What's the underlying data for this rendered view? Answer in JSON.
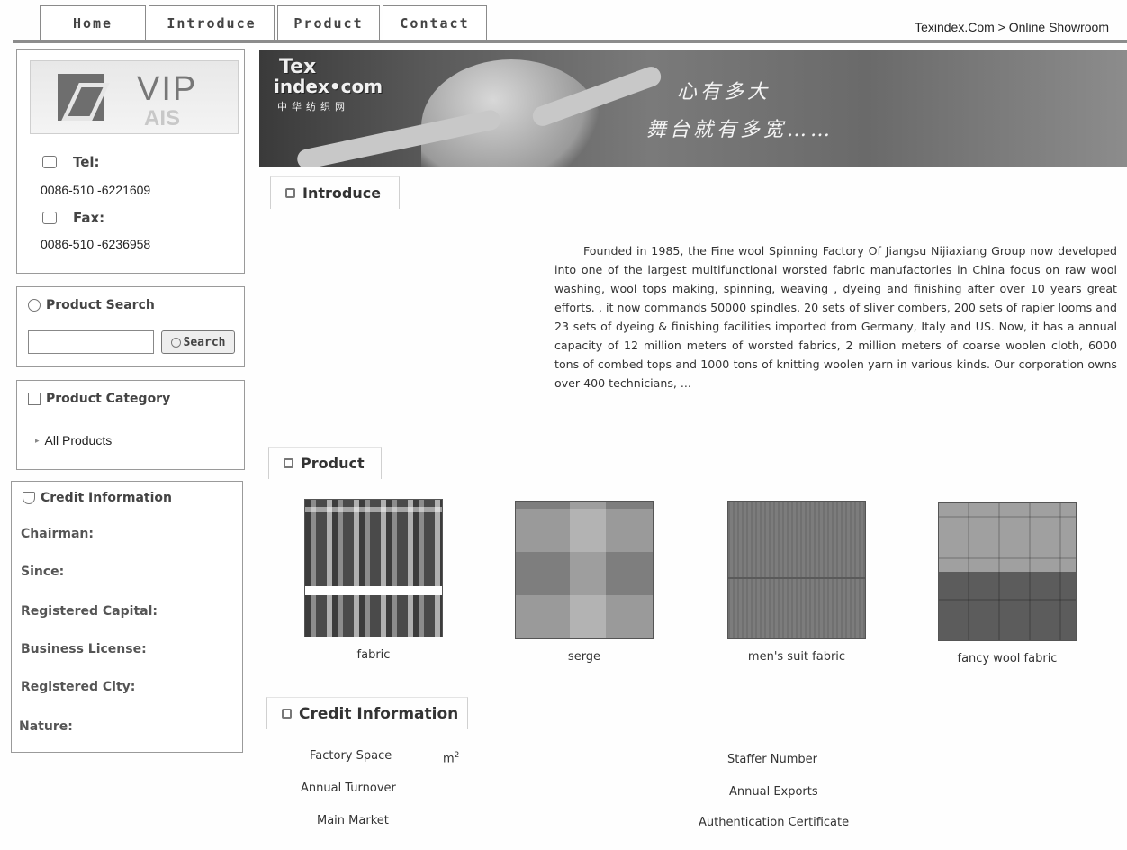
{
  "nav": {
    "tabs": [
      {
        "label": "Home"
      },
      {
        "label": "Introduce"
      },
      {
        "label": "Product"
      },
      {
        "label": "Contact"
      }
    ],
    "breadcrumb": "Texindex.Com > Online Showroom"
  },
  "sidebar": {
    "vip": {
      "logo_text": "VIP",
      "logo_subtext": "AIS"
    },
    "contact": {
      "tel_label": "Tel:",
      "tel": "0086-510 -6221609",
      "fax_label": "Fax:",
      "fax": "0086-510 -6236958"
    },
    "search": {
      "title": "Product Search",
      "input_value": "",
      "button_label": "Search"
    },
    "category": {
      "title": "Product Category",
      "items": [
        "All Products"
      ]
    },
    "credit": {
      "title": "Credit Information",
      "rows": [
        "Chairman:",
        "Since:",
        "Registered Capital:",
        "Business License:",
        "Registered City:",
        "Nature:"
      ]
    }
  },
  "banner": {
    "brand_line1": "Tex",
    "brand_line2": "index•com",
    "brand_cn": "中华纺织网",
    "slogan_line1": "心有多大",
    "slogan_line2": "舞台就有多宽……"
  },
  "introduce": {
    "title": "Introduce",
    "text": "Founded in 1985, the Fine wool Spinning Factory Of Jiangsu Nijiaxiang Group now developed into one of the largest multifunctional worsted fabric manufactories in China focus on raw wool washing, wool tops making, spinning, weaving , dyeing and finishing after over 10 years great efforts. , it now commands 50000 spindles, 20 sets of sliver combers, 200 sets of rapier looms and 23 sets of dyeing & finishing facilities imported from Germany, Italy and US. Now, it has a annual capacity of 12 million meters of worsted fabrics, 2 million meters of coarse woolen cloth, 6000 tons of combed tops and 1000 tons of knitting woolen yarn in various kinds. Our corporation owns over 400 technicians, ..."
  },
  "product": {
    "title": "Product",
    "items": [
      {
        "caption": "fabric"
      },
      {
        "caption": "serge"
      },
      {
        "caption": "men's suit fabric"
      },
      {
        "caption": "fancy wool fabric"
      }
    ]
  },
  "credit_info": {
    "title": "Credit Information",
    "factory_space": "Factory Space",
    "unit": "m",
    "unit_exp": "2",
    "annual_turnover": "Annual Turnover",
    "main_market": "Main Market",
    "staffer_number": "Staffer Number",
    "annual_exports": "Annual Exports",
    "certificate": "Authentication Certificate"
  }
}
